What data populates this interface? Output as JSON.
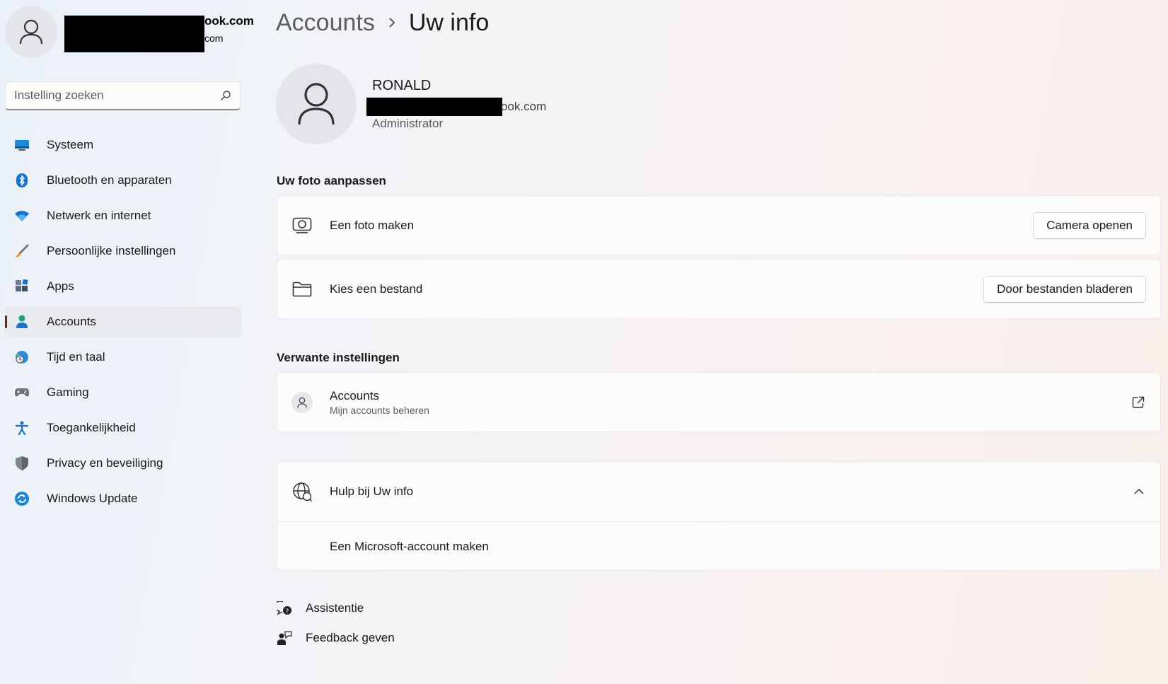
{
  "user": {
    "email_suffix": "ook.com",
    "email_line2_suffix": "com"
  },
  "search": {
    "placeholder": "Instelling zoeken"
  },
  "nav": {
    "items": [
      {
        "label": "Systeem",
        "icon": "monitor-icon"
      },
      {
        "label": "Bluetooth en apparaten",
        "icon": "bluetooth-icon"
      },
      {
        "label": "Netwerk en internet",
        "icon": "wifi-icon"
      },
      {
        "label": "Persoonlijke instellingen",
        "icon": "brush-icon"
      },
      {
        "label": "Apps",
        "icon": "apps-icon"
      },
      {
        "label": "Accounts",
        "icon": "person-icon",
        "active": true
      },
      {
        "label": "Tijd en taal",
        "icon": "globe-clock-icon"
      },
      {
        "label": "Gaming",
        "icon": "gamepad-icon"
      },
      {
        "label": "Toegankelijkheid",
        "icon": "accessibility-icon"
      },
      {
        "label": "Privacy en beveiliging",
        "icon": "shield-icon"
      },
      {
        "label": "Windows Update",
        "icon": "update-icon"
      }
    ]
  },
  "breadcrumb": {
    "parent": "Accounts",
    "current": "Uw info"
  },
  "profile": {
    "name": "RONALD",
    "email_suffix": "ook.com",
    "role": "Administrator"
  },
  "photo_section": {
    "title": "Uw foto aanpassen",
    "take_photo": {
      "label": "Een foto maken",
      "button": "Camera openen"
    },
    "choose_file": {
      "label": "Kies een bestand",
      "button": "Door bestanden bladeren"
    }
  },
  "related": {
    "title": "Verwante instellingen",
    "accounts": {
      "label": "Accounts",
      "sub": "Mijn accounts beheren"
    }
  },
  "help": {
    "title": "Hulp bij Uw info",
    "link": "Een Microsoft-account maken"
  },
  "footer": {
    "assist": "Assistentie",
    "feedback": "Feedback geven"
  },
  "colors": {
    "accent": "#0067c0",
    "active_indicator": "#5b2a1e",
    "redaction": "#000000"
  }
}
